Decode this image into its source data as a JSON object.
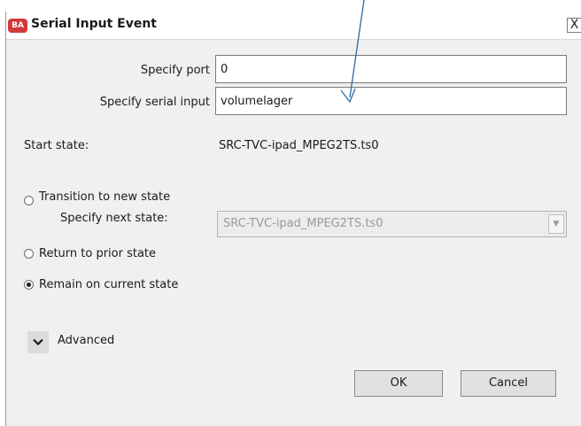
{
  "window": {
    "title": "Serial Input Event",
    "app_icon_text": "BA",
    "close_glyph": "X"
  },
  "form": {
    "port_label": "Specify port",
    "port_value": "0",
    "serial_label": "Specify serial input",
    "serial_value": "volumelager",
    "start_state_label": "Start state:",
    "start_state_value": "SRC-TVC-ipad_MPEG2TS.ts0"
  },
  "options": {
    "transition_label": "Transition to new state",
    "next_state_label": "Specify next state:",
    "next_state_value": "SRC-TVC-ipad_MPEG2TS.ts0",
    "return_label": "Return to prior state",
    "remain_label": "Remain on current state",
    "selected": "remain"
  },
  "advanced": {
    "label": "Advanced",
    "icon": "chevron-down-icon"
  },
  "buttons": {
    "ok": "OK",
    "cancel": "Cancel"
  },
  "colors": {
    "annotation_arrow": "#2e6aa6",
    "icon_red": "#d23a3a"
  }
}
